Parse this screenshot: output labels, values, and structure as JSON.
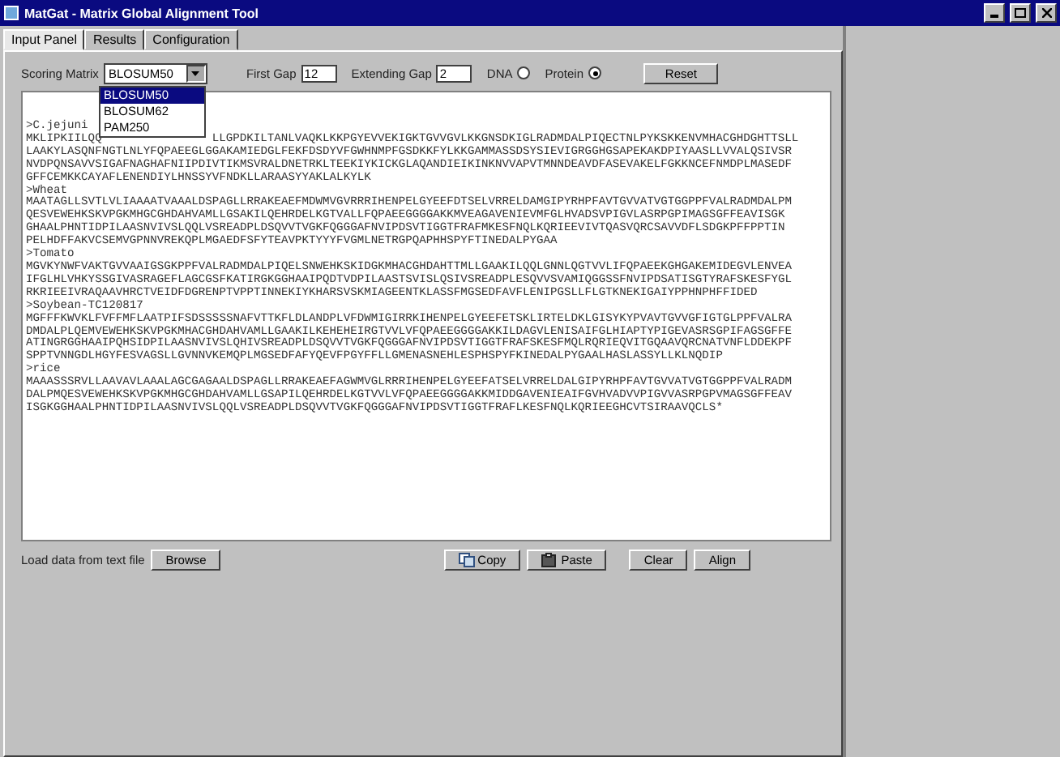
{
  "window": {
    "title": "MatGat - Matrix Global Alignment Tool"
  },
  "tabs": [
    {
      "label": "Input Panel",
      "selected": true
    },
    {
      "label": "Results",
      "selected": false
    },
    {
      "label": "Configuration",
      "selected": false
    }
  ],
  "scoring_matrix": {
    "label": "Scoring Matrix",
    "value": "BLOSUM50",
    "expanded": true,
    "options": [
      {
        "label": "BLOSUM50",
        "selected": true
      },
      {
        "label": "BLOSUM62",
        "selected": false
      },
      {
        "label": "PAM250",
        "selected": false
      }
    ]
  },
  "first_gap": {
    "label": "First Gap",
    "value": "12"
  },
  "extending_gap": {
    "label": "Extending Gap",
    "value": "2"
  },
  "sequence_type": [
    {
      "label": "DNA",
      "selected": false
    },
    {
      "label": "Protein",
      "selected": true
    }
  ],
  "reset_button": "Reset",
  "sequence_lines": [
    [
      ">C.jejuni"
    ],
    [
      "MKLIPKIILQQ",
      "LLGPDKILTANLVAQKLKKPGYEVVEKIGKTGVVGVLKKGNSDKIGLRADMDALPIQECTNLPYKSKKENVMHACGHDGHTTSLL"
    ],
    [
      "LAAKYLASQNFNGTLNLYFQPAEEGLGGAKAMIEDGLFEKFDSDYVFGWHNMPFGSDKKFYLKKGAMMASSDSYSIEVIGRGGHGSAPEKAKDPIYAASLLVVALQSIVSR"
    ],
    [
      "NVDPQNSAVVSIGAFNAGHAFNIIPDIVTIKMSVRALDNETRKLTEEKIYKICKGLAQANDIEIKINKNVVAPVTMNNDEAVDFASEVAKELFGKKNCEFNMDPLMASEDF"
    ],
    [
      "GFFCEMKKCAYAFLENENDIYLHNSSYVFNDKLLARAASYYAKLALKYLK"
    ],
    [
      ">Wheat"
    ],
    [
      "MAATAGLLSVTLVLIAAAATVAAALDSPAGLLRRAKEAEFMDWMVGVRRRIHENPELGYEEFDTSELVRRELDAMGIPYRHPFAVTGVVATVGTGGPPFVALRADMDALPM"
    ],
    [
      "QESVEWEHKSKVPGKMHGCGHDAHVAMLLGSAKILQEHRDELKGTVALLFQPAEEGGGGAKKMVEAGAVENIEVMFGLHVADSVPIGVLASRPGPIMAGSGFFEAVISGK"
    ],
    [
      "GHAALPHNTIDPILAASNVIVSLQQLVSREADPLDSQVVTVGKFQGGGAFNVIPDSVTIGGTFRAFMKESFNQLKQRIEEVIVTQASVQRCSAVVDFLSDGKPFFPPTIN"
    ],
    [
      "PELHDFFAKVCSEMVGPNNVREKQPLMGAEDFSFYTEAVPKTYYYFVGMLNETRGPQAPHHSPYFTINEDALPYGAA"
    ],
    [
      ">Tomato"
    ],
    [
      "MGVKYNWFVAKTGVVAAIGSGKPPFVALRADMDALPIQELSNWEHKSKIDGKMHACGHDAHTTMLLGAAKILQQLGNNLQGTVVLIFQPAEEKGHGAKEMIDEGVLENVEA"
    ],
    [
      "IFGLHLVHKYSSGIVASRAGEFLAGCGSFKATIRGKGGHAAIPQDTVDPILAASTSVISLQSIVSREADPLESQVVSVAMIQGGSSFNVIPDSATISGTYRAFSKESFYGL"
    ],
    [
      "RKRIEEIVRAQAAVHRCTVEIDFDGRENPTVPPTINNEKIYKHARSVSKMIAGEENTKLASSFMGSEDFAVFLENIPGSLLFLGTKNEKIGAIYPPHNPHFFIDED"
    ],
    [
      ">Soybean-TC120817"
    ],
    [
      "MGFFFKWVKLFVFFMFLAATPIFSDSSSSSNAFVTTKFLDLANDPLVFDWMIGIRRKIHENPELGYEEFETSKLIRTELDKLGISYKYPVAVTGVVGFIGTGLPPFVALRA"
    ],
    [
      "DMDALPLQEMVEWEHKSKVPGKMHACGHDAHVAMLLGAAKILKEHEHEIRGTVVLVFQPAEEGGGGAKKILDAGVLENISAIFGLHIAPTYPIGEVASRSGPIFAGSGFFE"
    ],
    [
      "ATINGRGGHAAIPQHSIDPILAASNVIVSLQHIVSREADPLDSQVVTVGKFQGGGAFNVIPDSVTIGGTFRAFSKESFMQLRQRIEQVITGQAAVQRCNATVNFLDDEKPF"
    ],
    [
      "SPPTVNNGDLHGYFESVAGSLLGVNNVKEMQPLMGSEDFAFYQEVFPGYFFLLGMENASNEHLESPHSPYFKINEDALPYGAALHASLASSYLLKLNQDIP"
    ],
    [
      ">rice"
    ],
    [
      "MAAASSSRVLLAAVAVLAAALAGCGAGAALDSPAGLLRRAKEAEFAGWMVGLRRRIHENPELGYEEFATSELVRRELDALGIPYRHPFAVTGVVATVGTGGPPFVALRADM"
    ],
    [
      "DALPMQESVEWEHKSKVPGKMHGCGHDAHVAMLLGSAPILQEHRDELKGTVVLVFQPAEEGGGGAKKMIDDGAVENIEAIFGVHVADVVPIGVVASRPGPVMAGSGFFEAV"
    ],
    [
      "ISGKGGHAALPHNTIDPILAASNVIVSLQQLVSREADPLDSQVVTVGKFQGGGAFNVIPDSVTIGGTFRAFLKESFNQLKQRIEEGHCVTSIRAAVQCLS*"
    ]
  ],
  "load_label": "Load data from text file",
  "browse_button": "Browse",
  "action_buttons": [
    {
      "label": "Copy",
      "kind": "copy"
    },
    {
      "label": "Paste",
      "kind": "paste"
    },
    {
      "label": "Clear",
      "kind": "plain"
    },
    {
      "label": "Align",
      "kind": "plain"
    }
  ]
}
